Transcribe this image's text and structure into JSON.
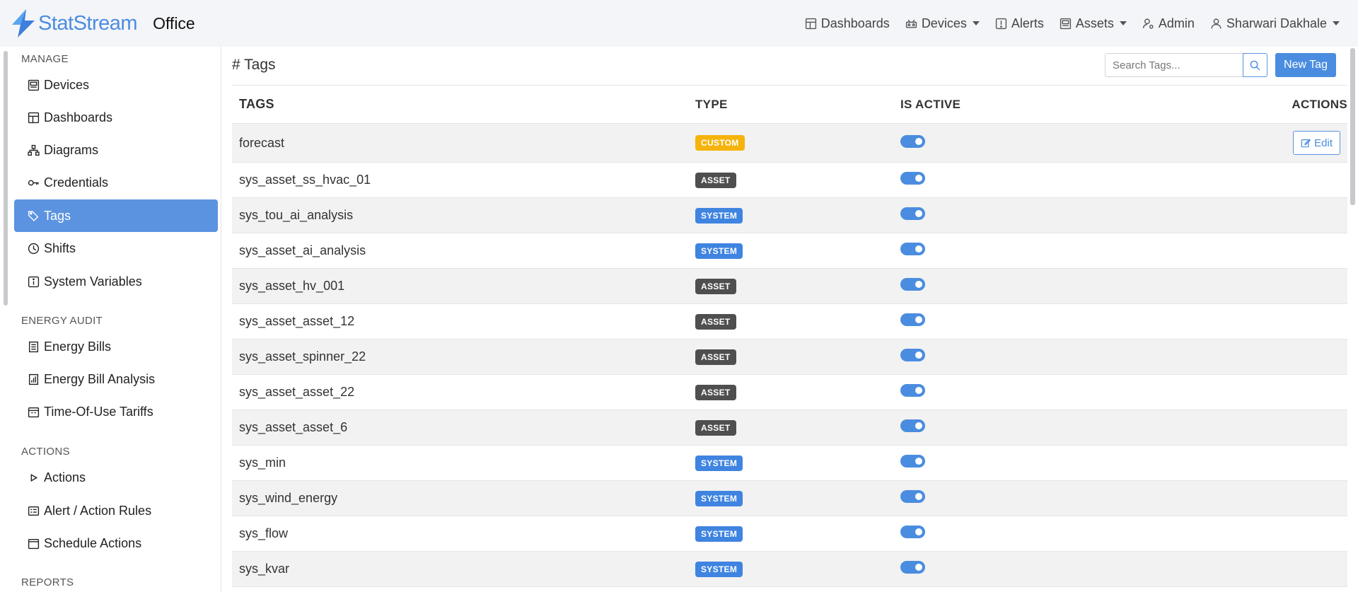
{
  "brand": {
    "name": "StatStream",
    "context": "Office"
  },
  "nav": {
    "dashboards": "Dashboards",
    "devices": "Devices",
    "alerts": "Alerts",
    "assets": "Assets",
    "admin": "Admin",
    "user": "Sharwari Dakhale"
  },
  "sidebar": {
    "sections": {
      "manage": "MANAGE",
      "energy_audit": "ENERGY AUDIT",
      "actions": "ACTIONS",
      "reports": "REPORTS"
    },
    "items": {
      "devices": "Devices",
      "dashboards": "Dashboards",
      "diagrams": "Diagrams",
      "credentials": "Credentials",
      "tags": "Tags",
      "shifts": "Shifts",
      "system_variables": "System Variables",
      "energy_bills": "Energy Bills",
      "energy_bill_analysis": "Energy Bill Analysis",
      "tou_tariffs": "Time-Of-Use Tariffs",
      "actions": "Actions",
      "alert_action_rules": "Alert / Action Rules",
      "schedule_actions": "Schedule Actions"
    },
    "active": "tags"
  },
  "page": {
    "title": "# Tags",
    "search_placeholder": "Search Tags...",
    "new_button": "New Tag",
    "edit_label": "Edit"
  },
  "table": {
    "headers": {
      "tags": "TAGS",
      "type": "TYPE",
      "is_active": "IS ACTIVE",
      "actions": "ACTIONS"
    },
    "rows": [
      {
        "name": "forecast",
        "type": "CUSTOM",
        "active": true
      },
      {
        "name": "sys_asset_ss_hvac_01",
        "type": "ASSET",
        "active": true
      },
      {
        "name": "sys_tou_ai_analysis",
        "type": "SYSTEM",
        "active": true
      },
      {
        "name": "sys_asset_ai_analysis",
        "type": "SYSTEM",
        "active": true
      },
      {
        "name": "sys_asset_hv_001",
        "type": "ASSET",
        "active": true
      },
      {
        "name": "sys_asset_asset_12",
        "type": "ASSET",
        "active": true
      },
      {
        "name": "sys_asset_spinner_22",
        "type": "ASSET",
        "active": true
      },
      {
        "name": "sys_asset_asset_22",
        "type": "ASSET",
        "active": true
      },
      {
        "name": "sys_asset_asset_6",
        "type": "ASSET",
        "active": true
      },
      {
        "name": "sys_min",
        "type": "SYSTEM",
        "active": true
      },
      {
        "name": "sys_wind_energy",
        "type": "SYSTEM",
        "active": true
      },
      {
        "name": "sys_flow",
        "type": "SYSTEM",
        "active": true
      },
      {
        "name": "sys_kvar",
        "type": "SYSTEM",
        "active": true
      }
    ]
  },
  "colors": {
    "accent": "#4a8de0",
    "active_item": "#5b93e1",
    "badge_custom": "#f5b30c",
    "badge_asset": "#4f4f4f",
    "badge_system": "#3f84e0"
  }
}
